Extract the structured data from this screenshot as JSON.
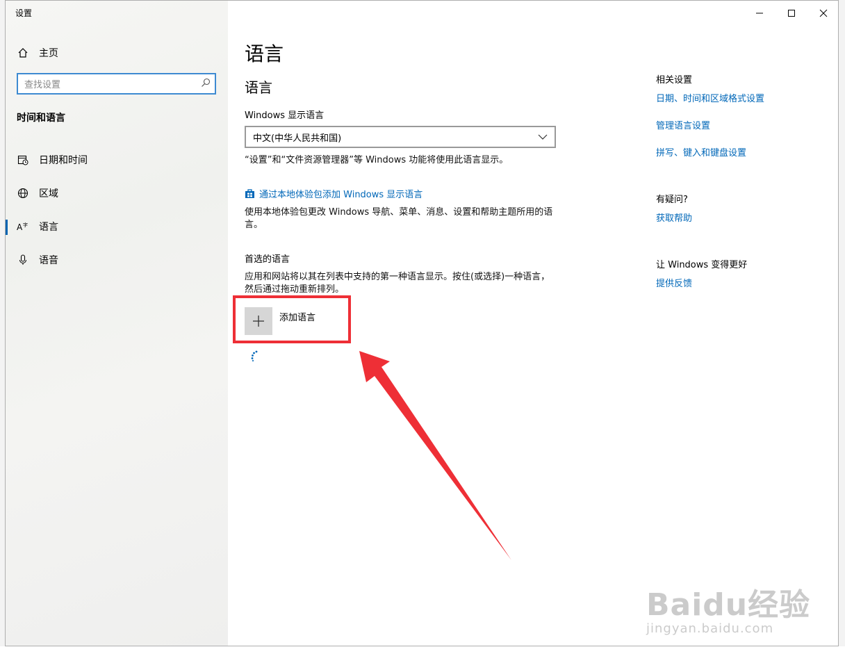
{
  "window": {
    "app_title": "设置"
  },
  "sidebar": {
    "home_label": "主页",
    "search_placeholder": "查找设置",
    "section_label": "时间和语言",
    "items": [
      {
        "label": "日期和时间",
        "icon": "calendar-clock-icon"
      },
      {
        "label": "区域",
        "icon": "globe-icon"
      },
      {
        "label": "语言",
        "icon": "language-icon",
        "active": true
      },
      {
        "label": "语音",
        "icon": "microphone-icon"
      }
    ]
  },
  "main": {
    "page_title": "语言",
    "section_title": "语言",
    "display_language_label": "Windows 显示语言",
    "display_language_value": "中文(中华人民共和国)",
    "display_language_desc": "“设置”和“文件资源管理器”等 Windows 功能将使用此语言显示。",
    "add_pack_link": "通过本地体验包添加 Windows 显示语言",
    "add_pack_desc": "使用本地体验包更改 Windows 导航、菜单、消息、设置和帮助主题所用的语言。",
    "preferred_label": "首选的语言",
    "preferred_desc": "应用和网站将以其在列表中支持的第一种语言显示。按住(或选择)一种语言，然后通过拖动重新排列。",
    "add_language_label": "添加语言"
  },
  "related": {
    "heading": "相关设置",
    "links": [
      "日期、时间和区域格式设置",
      "管理语言设置",
      "拼写、键入和键盘设置"
    ],
    "question_heading": "有疑问?",
    "help_link": "获取帮助",
    "feedback_heading": "让 Windows 变得更好",
    "feedback_link": "提供反馈"
  },
  "watermark": {
    "main": "Baidu经验",
    "sub": "jingyan.baidu.com"
  },
  "colors": {
    "accent": "#0067b8",
    "highlight_box": "#ee2f36"
  }
}
